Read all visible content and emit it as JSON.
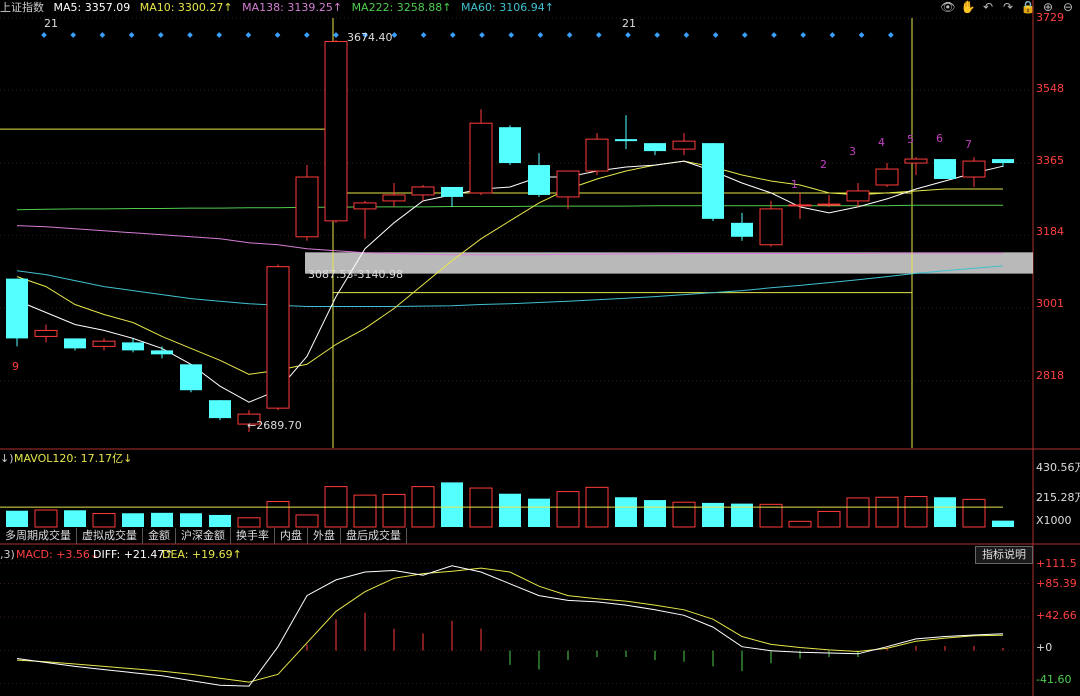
{
  "header": {
    "index_name": "上证指数",
    "ma5": "MA5: 3357.09",
    "ma10": "MA10: 3300.27↑",
    "ma138": "MA138: 3139.25↑",
    "ma222": "MA222: 3258.88↑",
    "ma60": "MA60: 3106.94↑"
  },
  "toolbar": {
    "eye": "👁",
    "hand": "✋",
    "undo": "↶",
    "redo": "↷",
    "lock": "🔒",
    "plus": "⊕",
    "minus": "⊖"
  },
  "price_axis": {
    "ticks": [
      "3729",
      "3548",
      "3365",
      "3184",
      "3001",
      "2818"
    ]
  },
  "volume_axis": {
    "ticks": [
      "430.56万",
      "215.28万",
      "X1000"
    ]
  },
  "macd_axis": {
    "ticks": [
      "+111.5",
      "+85.39",
      "+42.66",
      "+0",
      "-41.60"
    ]
  },
  "marks": {
    "top_21_a": "21",
    "top_21_b": "21",
    "count_9": "9",
    "count_1": "1",
    "count_2": "2",
    "count_3": "3",
    "count_4": "4",
    "count_5": "5",
    "count_6": "6",
    "count_7": "7",
    "high_label": "3674.40",
    "low_label": "←2689.70",
    "range_label": "3087.53-3140.98"
  },
  "volume_header": {
    "prefix": "↓)",
    "mavol": "MAVOL120: 17.17亿↓"
  },
  "tabs": [
    "多周期成交量",
    "虚拟成交量",
    "金额",
    "沪深金额",
    "换手率",
    "内盘",
    "外盘",
    "盘后成交量"
  ],
  "macd_header": {
    "prefix": ",3)",
    "macd": "MACD: +3.56↓",
    "diff": "DIFF: +21.47↑",
    "dea": "DEA: +19.69↑"
  },
  "indicator_button": "指标说明",
  "colors": {
    "up": "#ff3b3b",
    "down": "#54ffff",
    "ma5": "#ffffff",
    "ma10": "#e6e64a",
    "ma138": "#d47fd4",
    "ma222": "#4fcc4f",
    "ma60": "#41c0cf",
    "zone": "#d9d9d9"
  },
  "chart_data": {
    "type": "candlestick",
    "price_range": [
      2650,
      3729
    ],
    "candles": [
      {
        "o": 3075,
        "h": 3075,
        "c": 2925,
        "l": 2905
      },
      {
        "o": 2930,
        "h": 2960,
        "c": 2945,
        "l": 2915
      },
      {
        "o": 2925,
        "h": 2925,
        "c": 2900,
        "l": 2895
      },
      {
        "o": 2905,
        "h": 2925,
        "c": 2918,
        "l": 2895
      },
      {
        "o": 2915,
        "h": 2925,
        "c": 2895,
        "l": 2890
      },
      {
        "o": 2895,
        "h": 2905,
        "c": 2885,
        "l": 2875
      },
      {
        "o": 2860,
        "h": 2860,
        "c": 2795,
        "l": 2790
      },
      {
        "o": 2770,
        "h": 2770,
        "c": 2725,
        "l": 2720
      },
      {
        "o": 2710,
        "h": 2745,
        "c": 2735,
        "l": 2690
      },
      {
        "o": 2750,
        "h": 3110,
        "c": 3105,
        "l": 2745
      },
      {
        "o": 3180,
        "h": 3360,
        "c": 3330,
        "l": 3170
      },
      {
        "o": 3220,
        "h": 3674,
        "c": 3670,
        "l": 3215
      },
      {
        "o": 3250,
        "h": 3270,
        "c": 3265,
        "l": 3175
      },
      {
        "o": 3270,
        "h": 3315,
        "c": 3285,
        "l": 3255
      },
      {
        "o": 3285,
        "h": 3310,
        "c": 3305,
        "l": 3270
      },
      {
        "o": 3305,
        "h": 3305,
        "c": 3280,
        "l": 3255
      },
      {
        "o": 3290,
        "h": 3500,
        "c": 3465,
        "l": 3285
      },
      {
        "o": 3455,
        "h": 3460,
        "c": 3365,
        "l": 3360
      },
      {
        "o": 3360,
        "h": 3390,
        "c": 3285,
        "l": 3280
      },
      {
        "o": 3280,
        "h": 3340,
        "c": 3345,
        "l": 3250
      },
      {
        "o": 3345,
        "h": 3440,
        "c": 3425,
        "l": 3335
      },
      {
        "o": 3425,
        "h": 3485,
        "c": 3420,
        "l": 3400
      },
      {
        "o": 3415,
        "h": 3415,
        "c": 3395,
        "l": 3385
      },
      {
        "o": 3400,
        "h": 3440,
        "c": 3420,
        "l": 3385
      },
      {
        "o": 3415,
        "h": 3415,
        "c": 3225,
        "l": 3220
      },
      {
        "o": 3215,
        "h": 3240,
        "c": 3180,
        "l": 3170
      },
      {
        "o": 3160,
        "h": 3270,
        "c": 3250,
        "l": 3155
      },
      {
        "o": 3260,
        "h": 3290,
        "c": 3260,
        "l": 3225
      },
      {
        "o": 3260,
        "h": 3285,
        "c": 3262,
        "l": 3255
      },
      {
        "o": 3270,
        "h": 3315,
        "c": 3295,
        "l": 3255
      },
      {
        "o": 3310,
        "h": 3365,
        "c": 3350,
        "l": 3305
      },
      {
        "o": 3365,
        "h": 3380,
        "c": 3375,
        "l": 3335
      },
      {
        "o": 3375,
        "h": 3375,
        "c": 3325,
        "l": 3325
      },
      {
        "o": 3330,
        "h": 3380,
        "c": 3370,
        "l": 3305
      },
      {
        "o": 3375,
        "h": 3375,
        "c": 3365,
        "l": 3355
      }
    ],
    "ma5": [
      3020,
      2990,
      2960,
      2945,
      2925,
      2900,
      2860,
      2805,
      2765,
      2795,
      2880,
      3030,
      3150,
      3215,
      3270,
      3285,
      3300,
      3305,
      3330,
      3330,
      3345,
      3355,
      3360,
      3370,
      3345,
      3315,
      3290,
      3255,
      3240,
      3255,
      3275,
      3300,
      3320,
      3340,
      3357
    ],
    "ma10": [
      3080,
      3055,
      3010,
      2985,
      2965,
      2930,
      2900,
      2870,
      2835,
      2845,
      2860,
      2910,
      2950,
      3000,
      3060,
      3120,
      3175,
      3220,
      3265,
      3300,
      3325,
      3345,
      3360,
      3370,
      3355,
      3335,
      3320,
      3310,
      3290,
      3285,
      3290,
      3295,
      3300,
      3300,
      3300
    ],
    "ma138": [
      3208,
      3205,
      3200,
      3195,
      3190,
      3185,
      3180,
      3175,
      3165,
      3160,
      3150,
      3145,
      3140,
      3138,
      3136,
      3135,
      3135,
      3135,
      3135,
      3136,
      3136,
      3137,
      3137,
      3138,
      3138,
      3138,
      3138,
      3138,
      3138,
      3138,
      3139,
      3139,
      3139,
      3139,
      3139
    ],
    "ma222": [
      3248,
      3249,
      3250,
      3250,
      3251,
      3251,
      3252,
      3252,
      3253,
      3253,
      3254,
      3254,
      3255,
      3255,
      3255,
      3256,
      3256,
      3256,
      3257,
      3257,
      3257,
      3257,
      3258,
      3258,
      3258,
      3258,
      3258,
      3258,
      3258,
      3258,
      3258,
      3259,
      3259,
      3259,
      3259
    ],
    "ma60": [
      3095,
      3085,
      3070,
      3055,
      3045,
      3035,
      3025,
      3018,
      3012,
      3008,
      3005,
      3005,
      3005,
      3005,
      3006,
      3007,
      3010,
      3012,
      3015,
      3018,
      3022,
      3026,
      3030,
      3035,
      3040,
      3045,
      3052,
      3058,
      3065,
      3072,
      3080,
      3088,
      3095,
      3101,
      3107
    ],
    "highlight_zone": [
      3087.53,
      3140.98
    ],
    "volume_range": [
      0,
      430.56
    ],
    "volume": [
      115,
      120,
      118,
      95,
      97,
      100,
      97,
      85,
      65,
      180,
      85,
      285,
      225,
      230,
      285,
      315,
      275,
      235,
      200,
      250,
      280,
      210,
      190,
      175,
      170,
      165,
      160,
      40,
      110,
      205,
      210,
      215,
      210,
      195,
      45
    ],
    "mavol120": 140,
    "macd_range": [
      -50,
      111.5
    ],
    "diff": [
      -10,
      -15,
      -20,
      -24,
      -28,
      -32,
      -38,
      -44,
      -45,
      5,
      70,
      90,
      100,
      102,
      96,
      108,
      100,
      85,
      70,
      64,
      62,
      58,
      52,
      45,
      30,
      5,
      0,
      -2,
      -3,
      -4,
      5,
      15,
      18,
      20,
      21.5
    ],
    "dea": [
      -12,
      -14,
      -17,
      -20,
      -23,
      -26,
      -30,
      -35,
      -40,
      -30,
      10,
      50,
      75,
      92,
      98,
      101,
      105,
      100,
      82,
      70,
      66,
      63,
      58,
      52,
      40,
      18,
      8,
      4,
      1,
      -1,
      3,
      12,
      16,
      19,
      19.69
    ],
    "macd_hist": [
      0,
      0,
      0,
      0,
      0,
      0,
      0,
      0,
      0,
      0,
      8,
      40,
      48,
      28,
      22,
      38,
      28,
      -18,
      -24,
      -12,
      -8,
      -8,
      -12,
      -14,
      -20,
      -26,
      -16,
      -10,
      -8,
      -8,
      4,
      6,
      6,
      6,
      3.56
    ]
  }
}
